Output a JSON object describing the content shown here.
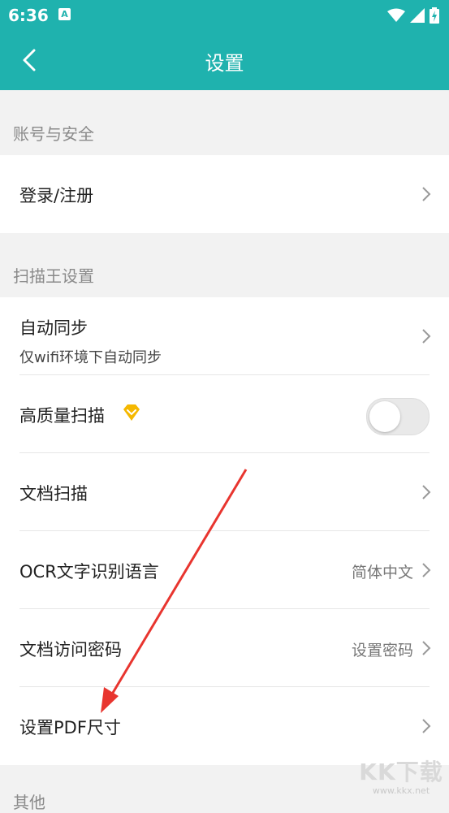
{
  "status_bar": {
    "time": "6:36",
    "notif_letter": "A"
  },
  "app_bar": {
    "title": "设置"
  },
  "sections": [
    {
      "header": "账号与安全",
      "rows": [
        {
          "label": "登录/注册"
        }
      ]
    },
    {
      "header": "扫描王设置",
      "rows": [
        {
          "label": "自动同步",
          "sublabel": "仅wifi环境下自动同步"
        },
        {
          "label": "高质量扫描",
          "toggle_on": false
        },
        {
          "label": "文档扫描"
        },
        {
          "label": "OCR文字识别语言",
          "value": "简体中文"
        },
        {
          "label": "文档访问密码",
          "value": "设置密码"
        },
        {
          "label": "设置PDF尺寸"
        }
      ]
    }
  ],
  "bottom_section_partial": "其他",
  "watermark": {
    "main": "KK下载",
    "url": "www.kkx.net"
  },
  "colors": {
    "teal": "#1fb2ae",
    "arrow": "#e8352f",
    "vip": "#f5b800"
  }
}
